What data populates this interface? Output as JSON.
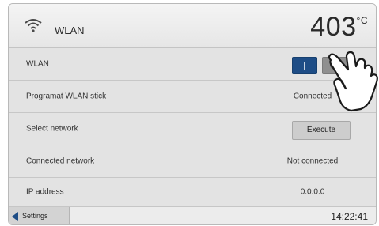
{
  "header": {
    "title": "WLAN",
    "temperature": "403",
    "temperature_unit": "°C",
    "icon": "wifi-icon"
  },
  "rows": [
    {
      "label": "WLAN",
      "toggle_on_label": "I"
    },
    {
      "label": "Programat WLAN stick",
      "value": "Connected"
    },
    {
      "label": "Select network",
      "button_label": "Execute"
    },
    {
      "label": "Connected network",
      "value": "Not connected"
    },
    {
      "label": "IP address",
      "value": "0.0.0.0"
    }
  ],
  "footer": {
    "back_label": "Settings",
    "time": "14:22:41"
  },
  "colors": {
    "accent": "#1e4d86",
    "background": "#e3e3e3"
  }
}
